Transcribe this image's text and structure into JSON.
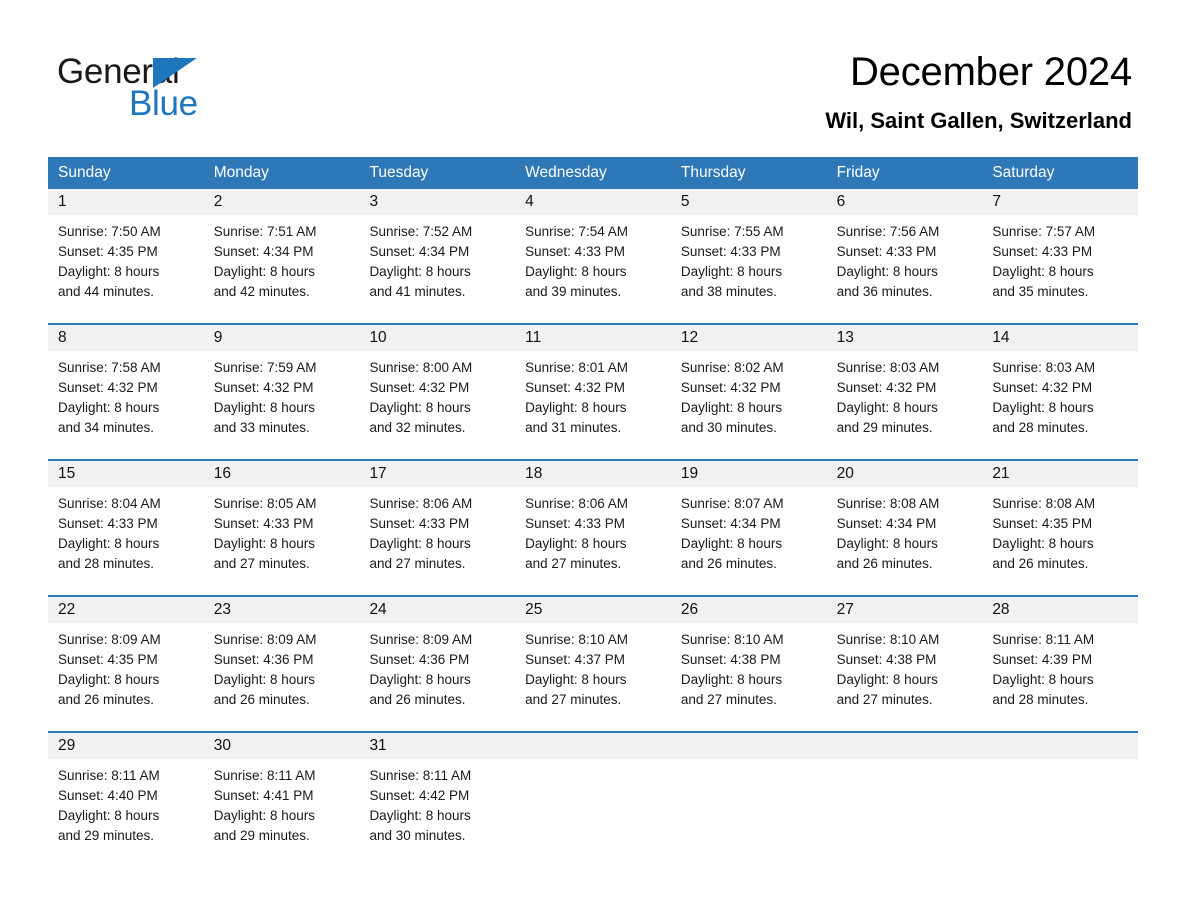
{
  "brand": {
    "name_part1": "General",
    "name_part2": "Blue",
    "accent_color": "#1f76bc",
    "triangle_icon": "triangle-right-icon"
  },
  "header": {
    "title": "December 2024",
    "subtitle": "Wil, Saint Gallen, Switzerland"
  },
  "calendar": {
    "header_bg": "#2e78b8",
    "daynum_bg": "#f1f1f1",
    "weekdays": [
      "Sunday",
      "Monday",
      "Tuesday",
      "Wednesday",
      "Thursday",
      "Friday",
      "Saturday"
    ],
    "weeks": [
      [
        {
          "day": "1",
          "sunrise": "Sunrise: 7:50 AM",
          "sunset": "Sunset: 4:35 PM",
          "daylight_line1": "Daylight: 8 hours",
          "daylight_line2": "and 44 minutes."
        },
        {
          "day": "2",
          "sunrise": "Sunrise: 7:51 AM",
          "sunset": "Sunset: 4:34 PM",
          "daylight_line1": "Daylight: 8 hours",
          "daylight_line2": "and 42 minutes."
        },
        {
          "day": "3",
          "sunrise": "Sunrise: 7:52 AM",
          "sunset": "Sunset: 4:34 PM",
          "daylight_line1": "Daylight: 8 hours",
          "daylight_line2": "and 41 minutes."
        },
        {
          "day": "4",
          "sunrise": "Sunrise: 7:54 AM",
          "sunset": "Sunset: 4:33 PM",
          "daylight_line1": "Daylight: 8 hours",
          "daylight_line2": "and 39 minutes."
        },
        {
          "day": "5",
          "sunrise": "Sunrise: 7:55 AM",
          "sunset": "Sunset: 4:33 PM",
          "daylight_line1": "Daylight: 8 hours",
          "daylight_line2": "and 38 minutes."
        },
        {
          "day": "6",
          "sunrise": "Sunrise: 7:56 AM",
          "sunset": "Sunset: 4:33 PM",
          "daylight_line1": "Daylight: 8 hours",
          "daylight_line2": "and 36 minutes."
        },
        {
          "day": "7",
          "sunrise": "Sunrise: 7:57 AM",
          "sunset": "Sunset: 4:33 PM",
          "daylight_line1": "Daylight: 8 hours",
          "daylight_line2": "and 35 minutes."
        }
      ],
      [
        {
          "day": "8",
          "sunrise": "Sunrise: 7:58 AM",
          "sunset": "Sunset: 4:32 PM",
          "daylight_line1": "Daylight: 8 hours",
          "daylight_line2": "and 34 minutes."
        },
        {
          "day": "9",
          "sunrise": "Sunrise: 7:59 AM",
          "sunset": "Sunset: 4:32 PM",
          "daylight_line1": "Daylight: 8 hours",
          "daylight_line2": "and 33 minutes."
        },
        {
          "day": "10",
          "sunrise": "Sunrise: 8:00 AM",
          "sunset": "Sunset: 4:32 PM",
          "daylight_line1": "Daylight: 8 hours",
          "daylight_line2": "and 32 minutes."
        },
        {
          "day": "11",
          "sunrise": "Sunrise: 8:01 AM",
          "sunset": "Sunset: 4:32 PM",
          "daylight_line1": "Daylight: 8 hours",
          "daylight_line2": "and 31 minutes."
        },
        {
          "day": "12",
          "sunrise": "Sunrise: 8:02 AM",
          "sunset": "Sunset: 4:32 PM",
          "daylight_line1": "Daylight: 8 hours",
          "daylight_line2": "and 30 minutes."
        },
        {
          "day": "13",
          "sunrise": "Sunrise: 8:03 AM",
          "sunset": "Sunset: 4:32 PM",
          "daylight_line1": "Daylight: 8 hours",
          "daylight_line2": "and 29 minutes."
        },
        {
          "day": "14",
          "sunrise": "Sunrise: 8:03 AM",
          "sunset": "Sunset: 4:32 PM",
          "daylight_line1": "Daylight: 8 hours",
          "daylight_line2": "and 28 minutes."
        }
      ],
      [
        {
          "day": "15",
          "sunrise": "Sunrise: 8:04 AM",
          "sunset": "Sunset: 4:33 PM",
          "daylight_line1": "Daylight: 8 hours",
          "daylight_line2": "and 28 minutes."
        },
        {
          "day": "16",
          "sunrise": "Sunrise: 8:05 AM",
          "sunset": "Sunset: 4:33 PM",
          "daylight_line1": "Daylight: 8 hours",
          "daylight_line2": "and 27 minutes."
        },
        {
          "day": "17",
          "sunrise": "Sunrise: 8:06 AM",
          "sunset": "Sunset: 4:33 PM",
          "daylight_line1": "Daylight: 8 hours",
          "daylight_line2": "and 27 minutes."
        },
        {
          "day": "18",
          "sunrise": "Sunrise: 8:06 AM",
          "sunset": "Sunset: 4:33 PM",
          "daylight_line1": "Daylight: 8 hours",
          "daylight_line2": "and 27 minutes."
        },
        {
          "day": "19",
          "sunrise": "Sunrise: 8:07 AM",
          "sunset": "Sunset: 4:34 PM",
          "daylight_line1": "Daylight: 8 hours",
          "daylight_line2": "and 26 minutes."
        },
        {
          "day": "20",
          "sunrise": "Sunrise: 8:08 AM",
          "sunset": "Sunset: 4:34 PM",
          "daylight_line1": "Daylight: 8 hours",
          "daylight_line2": "and 26 minutes."
        },
        {
          "day": "21",
          "sunrise": "Sunrise: 8:08 AM",
          "sunset": "Sunset: 4:35 PM",
          "daylight_line1": "Daylight: 8 hours",
          "daylight_line2": "and 26 minutes."
        }
      ],
      [
        {
          "day": "22",
          "sunrise": "Sunrise: 8:09 AM",
          "sunset": "Sunset: 4:35 PM",
          "daylight_line1": "Daylight: 8 hours",
          "daylight_line2": "and 26 minutes."
        },
        {
          "day": "23",
          "sunrise": "Sunrise: 8:09 AM",
          "sunset": "Sunset: 4:36 PM",
          "daylight_line1": "Daylight: 8 hours",
          "daylight_line2": "and 26 minutes."
        },
        {
          "day": "24",
          "sunrise": "Sunrise: 8:09 AM",
          "sunset": "Sunset: 4:36 PM",
          "daylight_line1": "Daylight: 8 hours",
          "daylight_line2": "and 26 minutes."
        },
        {
          "day": "25",
          "sunrise": "Sunrise: 8:10 AM",
          "sunset": "Sunset: 4:37 PM",
          "daylight_line1": "Daylight: 8 hours",
          "daylight_line2": "and 27 minutes."
        },
        {
          "day": "26",
          "sunrise": "Sunrise: 8:10 AM",
          "sunset": "Sunset: 4:38 PM",
          "daylight_line1": "Daylight: 8 hours",
          "daylight_line2": "and 27 minutes."
        },
        {
          "day": "27",
          "sunrise": "Sunrise: 8:10 AM",
          "sunset": "Sunset: 4:38 PM",
          "daylight_line1": "Daylight: 8 hours",
          "daylight_line2": "and 27 minutes."
        },
        {
          "day": "28",
          "sunrise": "Sunrise: 8:11 AM",
          "sunset": "Sunset: 4:39 PM",
          "daylight_line1": "Daylight: 8 hours",
          "daylight_line2": "and 28 minutes."
        }
      ],
      [
        {
          "day": "29",
          "sunrise": "Sunrise: 8:11 AM",
          "sunset": "Sunset: 4:40 PM",
          "daylight_line1": "Daylight: 8 hours",
          "daylight_line2": "and 29 minutes."
        },
        {
          "day": "30",
          "sunrise": "Sunrise: 8:11 AM",
          "sunset": "Sunset: 4:41 PM",
          "daylight_line1": "Daylight: 8 hours",
          "daylight_line2": "and 29 minutes."
        },
        {
          "day": "31",
          "sunrise": "Sunrise: 8:11 AM",
          "sunset": "Sunset: 4:42 PM",
          "daylight_line1": "Daylight: 8 hours",
          "daylight_line2": "and 30 minutes."
        },
        {
          "day": "",
          "sunrise": "",
          "sunset": "",
          "daylight_line1": "",
          "daylight_line2": ""
        },
        {
          "day": "",
          "sunrise": "",
          "sunset": "",
          "daylight_line1": "",
          "daylight_line2": ""
        },
        {
          "day": "",
          "sunrise": "",
          "sunset": "",
          "daylight_line1": "",
          "daylight_line2": ""
        },
        {
          "day": "",
          "sunrise": "",
          "sunset": "",
          "daylight_line1": "",
          "daylight_line2": ""
        }
      ]
    ]
  }
}
